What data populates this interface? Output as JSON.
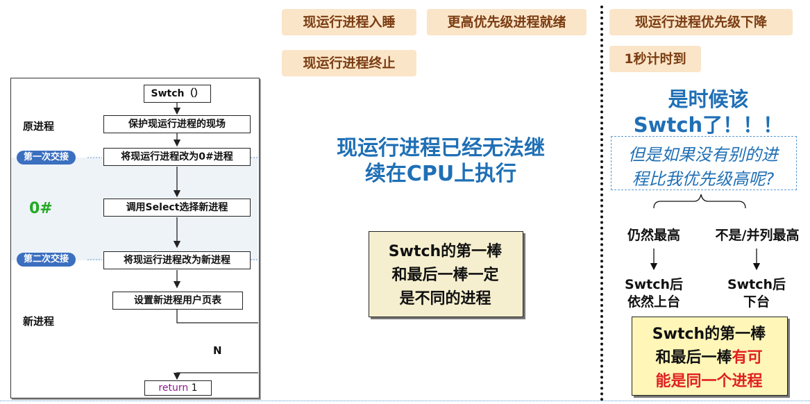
{
  "tags": {
    "sleep": "现运行进程入睡",
    "higher_ready": "更高优先级进程就绪",
    "priority_drop": "现运行进程优先级下降",
    "terminate": "现运行进程终止",
    "timeout": "1秒计时到"
  },
  "flow": {
    "start": "Swtch（）",
    "protect": "保护现运行进程的现场",
    "to_zero": "将现运行进程改为0#进程",
    "select": "调用Select选择新进程",
    "to_new": "将现运行进程改为新进程",
    "page_table": "设置新进程用户页表",
    "ret_keyword": "return",
    "ret_value": "1",
    "n_label": "N",
    "orig_process": "原进程",
    "new_process": "新进程",
    "zero_label": "0#",
    "first_handover": "第一次交接",
    "second_handover": "第二次交接"
  },
  "middle": {
    "cannot_continue_1": "现运行进程已经无法继",
    "cannot_continue_2": "续在CPU上执行",
    "box_1": "Swtch的第一棒",
    "box_2": "和最后一棒一定",
    "box_3": "是不同的进程"
  },
  "right": {
    "time_1": "是时候该",
    "time_2": "Swtch了！！！",
    "question_1": "但是如果没有别的进",
    "question_2": "程比我优先级高呢?",
    "still_highest": "仍然最高",
    "not_highest": "不是/并列最高",
    "stay_1": "Swtch后",
    "stay_2": "依然上台",
    "leave_1": "Swtch后",
    "leave_2": "下台",
    "box_1": "Swtch的第一棒",
    "box_2a": "和最后一棒",
    "box_2b": "有可",
    "box_3a": "能是同一个进程"
  },
  "colors": {
    "tag_bg": "#fbe5c8",
    "tag_text": "#7a3c12",
    "blue_title": "#1f6fb5",
    "green_zero": "#22aa22",
    "red_emphasis": "#e02020",
    "pill_bg": "#3b6fbf",
    "khaki_box": "#f5efcf",
    "yellow_box": "#fff6b8"
  }
}
